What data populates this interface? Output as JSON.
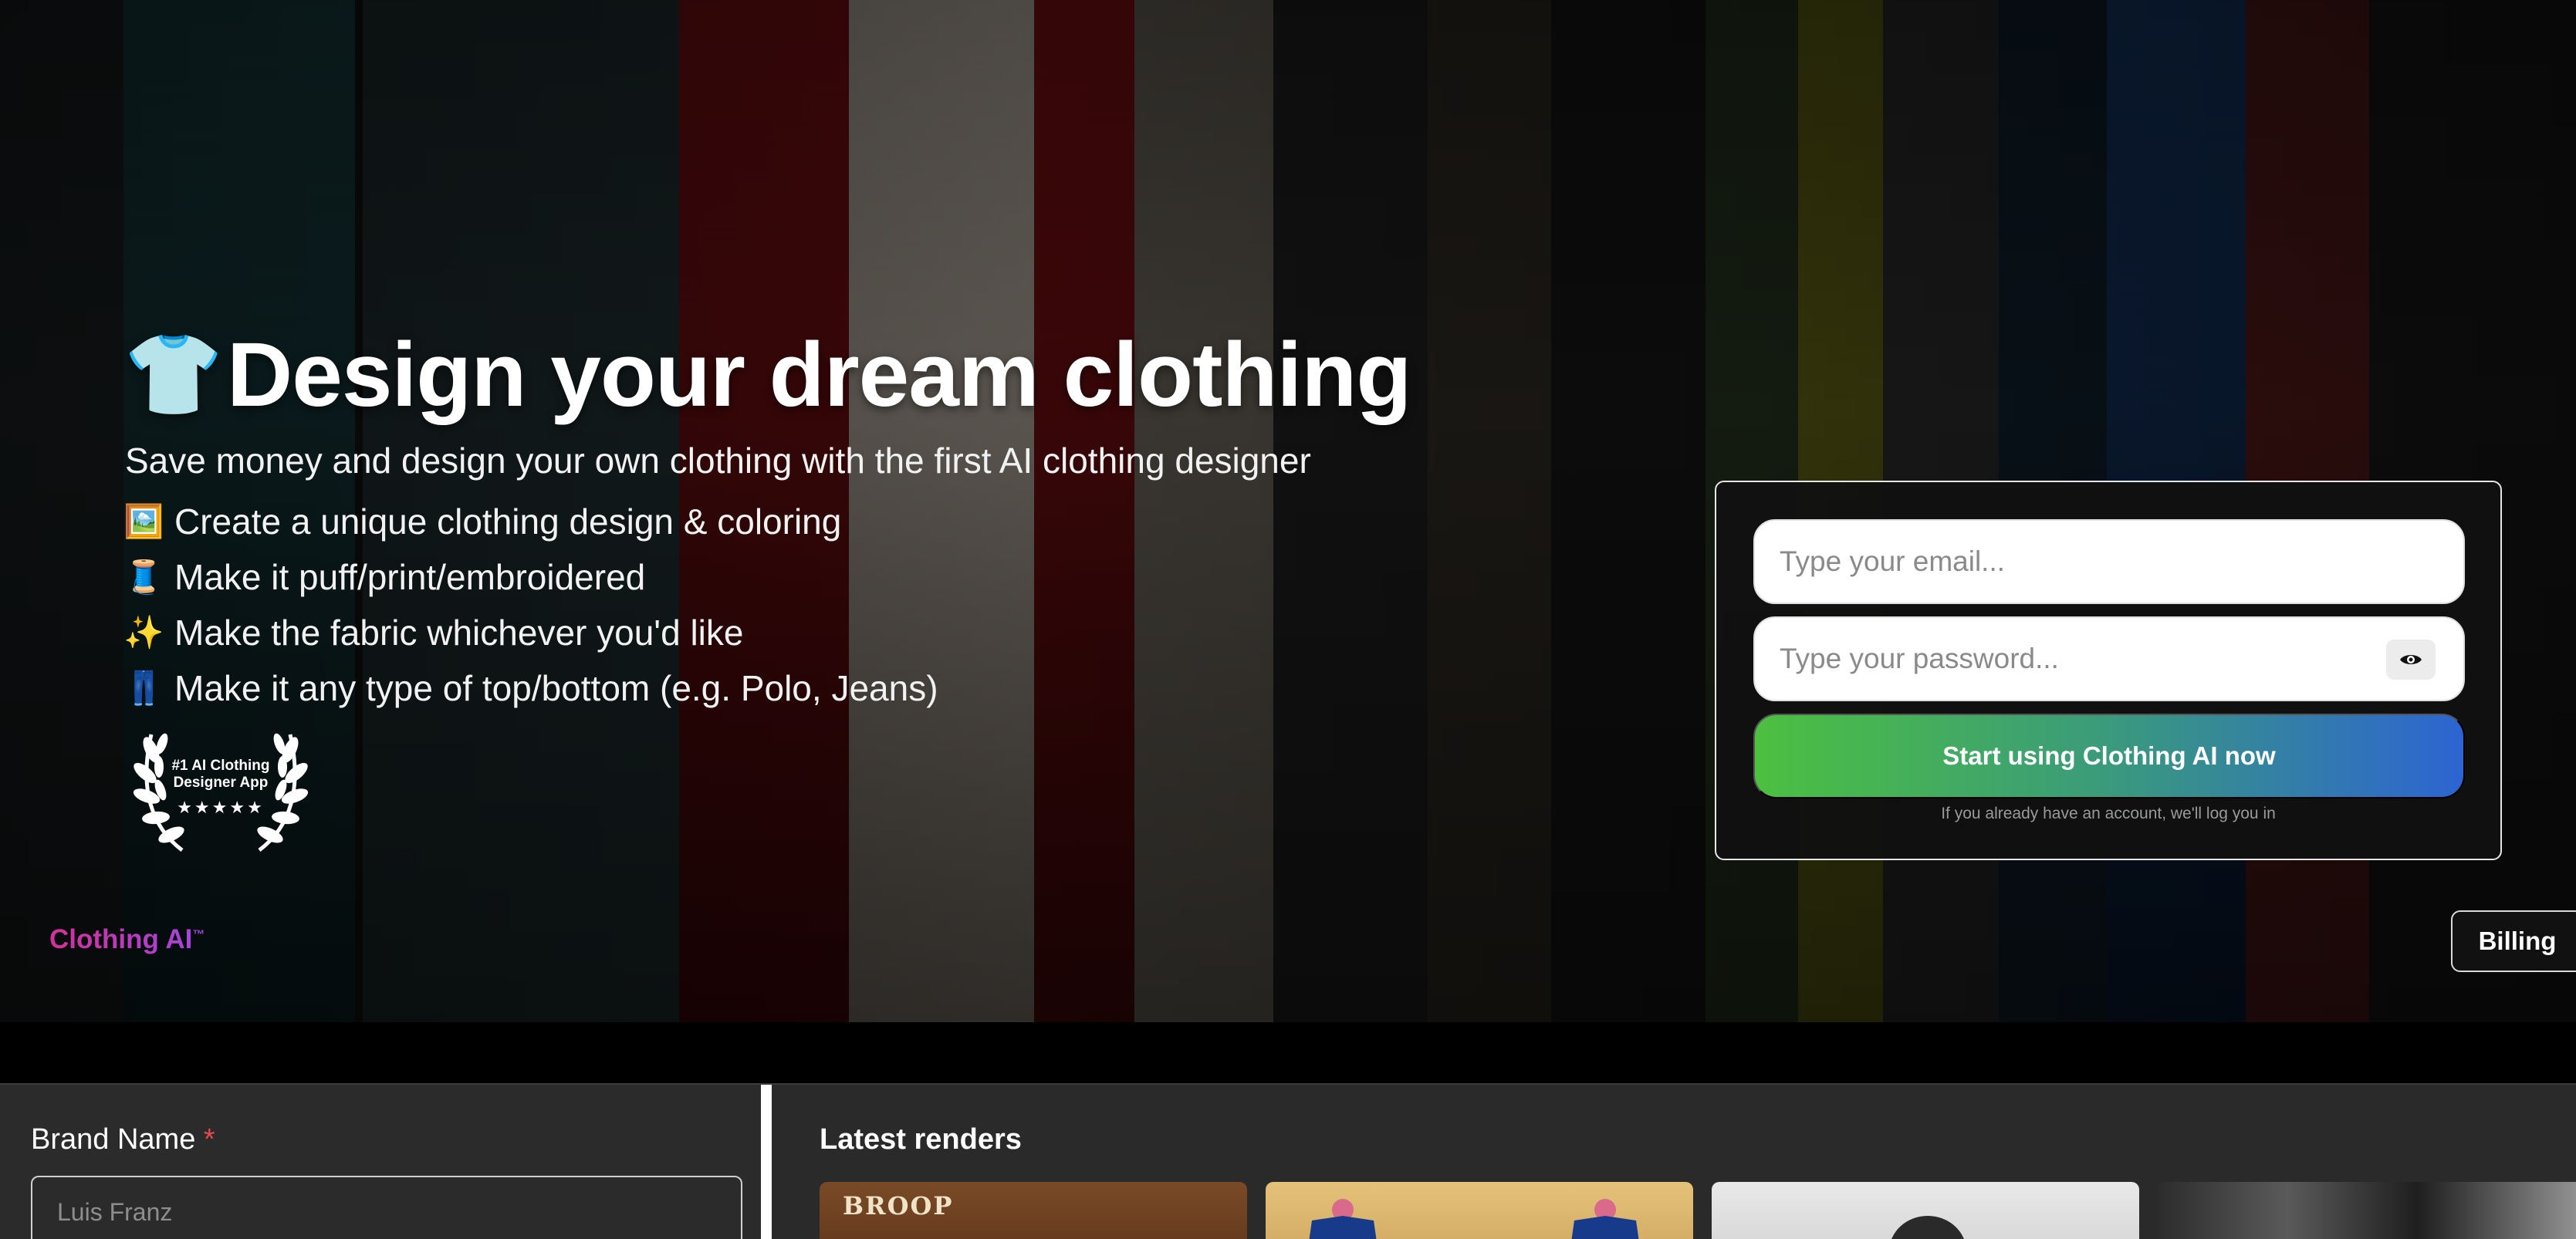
{
  "hero": {
    "title_icon": "👕",
    "title": "Design your dream clothing",
    "subtitle": "Save money and design your own clothing with the first AI clothing designer",
    "features": [
      {
        "icon": "🖼️",
        "icon_name": "framed-picture-icon",
        "text": "Create a unique clothing design & coloring"
      },
      {
        "icon": "🧵",
        "icon_name": "thread-spool-icon",
        "text": "Make it puff/print/embroidered"
      },
      {
        "icon": "✨",
        "icon_name": "sparkles-icon",
        "text": "Make the fabric whichever you'd like"
      },
      {
        "icon": "👖",
        "icon_name": "jeans-icon",
        "text": "Make it any type of top/bottom (e.g. Polo, Jeans)"
      }
    ],
    "award_line1": "#1 AI Clothing",
    "award_line2": "Designer App",
    "award_stars": "★★★★★"
  },
  "nav": {
    "brand": "Clothing AI",
    "brand_tm": "™",
    "billing_label": "Billing"
  },
  "signup": {
    "email_placeholder": "Type your email...",
    "password_placeholder": "Type your password...",
    "submit_label": "Start using Clothing AI now",
    "note": "If you already have an account, we'll log you in"
  },
  "form": {
    "brand_name_label": "Brand Name",
    "required_mark": "*",
    "brand_name_placeholder": "Luis Franz"
  },
  "renders": {
    "title": "Latest renders",
    "render1_text": "BROOP"
  },
  "colors": {
    "brand_gradient_start": "#d3319a",
    "brand_gradient_end": "#a145e0",
    "cta_gradient_start": "#4cc040",
    "cta_gradient_end": "#2d64d2",
    "required": "#e5484d"
  }
}
